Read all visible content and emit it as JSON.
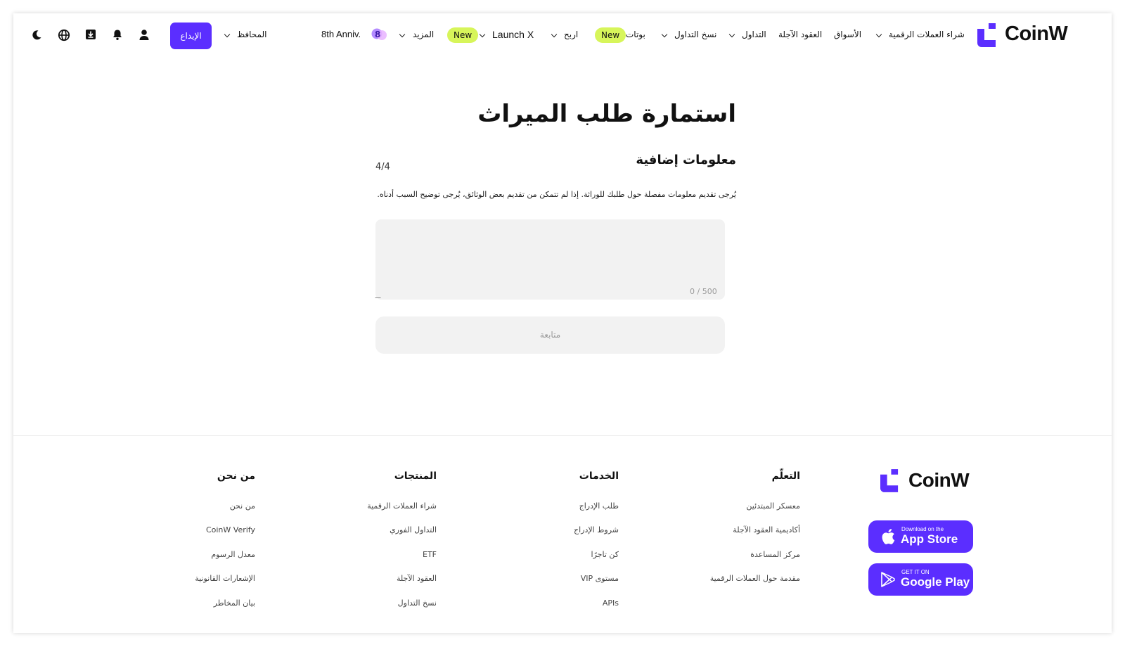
{
  "header": {
    "logo_text": "CoinW",
    "nav": {
      "buy_crypto": "شراء العملات الرقمية",
      "markets": "الأسواق",
      "futures": "العقود الآجلة",
      "trading": "التداول",
      "copy_trading": "نسخ التداول",
      "bots": "بوتات",
      "bots_badge": "New",
      "earn": "اربح",
      "launchx": "Launch X",
      "launchx_badge": "New",
      "more": "المزيد",
      "anniv": "8th Anniv.",
      "wallets": "المحافظ"
    },
    "deposit_label": "الإيداع",
    "icons": [
      "user-icon",
      "bell-icon",
      "download-icon",
      "globe-icon",
      "moon-icon"
    ]
  },
  "form": {
    "title": "استمارة طلب الميراث",
    "section_title": "معلومات إضافية",
    "step": "4/4",
    "instruction": "يُرجى تقديم معلومات مفصلة حول طلبك للوراثة. إذا لم تتمكن من تقديم بعض الوثائق، يُرجى توضيح السبب أدناه.",
    "textarea_value": "",
    "char_counter": "0 / 500",
    "continue_label": "متابعة"
  },
  "footer": {
    "logo_text": "CoinW",
    "columns": [
      {
        "title": "التعلّم",
        "links": [
          "معسكر المبتدئين",
          "أكاديمية العقود الآجلة",
          "مركز المساعدة",
          "مقدمة حول العملات الرقمية"
        ]
      },
      {
        "title": "الخدمات",
        "links": [
          "طلب الإدراج",
          "شروط الإدراج",
          "كن تاجرًا",
          "مستوى VIP",
          "APIs"
        ]
      },
      {
        "title": "المنتجات",
        "links": [
          "شراء العملات الرقمية",
          "التداول الفوري",
          "ETF",
          "العقود الآجلة",
          "نسخ التداول"
        ]
      },
      {
        "title": "من نحن",
        "links": [
          "من نحن",
          "CoinW Verify",
          "معدل الرسوم",
          "الإشعارات القانونية",
          "بيان المخاطر"
        ]
      }
    ],
    "app_store": {
      "small": "Download on the",
      "big": "App Store"
    },
    "google_play": {
      "small": "GET IT ON",
      "big": "Google Play"
    }
  },
  "colors": {
    "accent": "#5b2eff",
    "badge": "#d7f55a",
    "field_bg": "#f2f2f2"
  }
}
